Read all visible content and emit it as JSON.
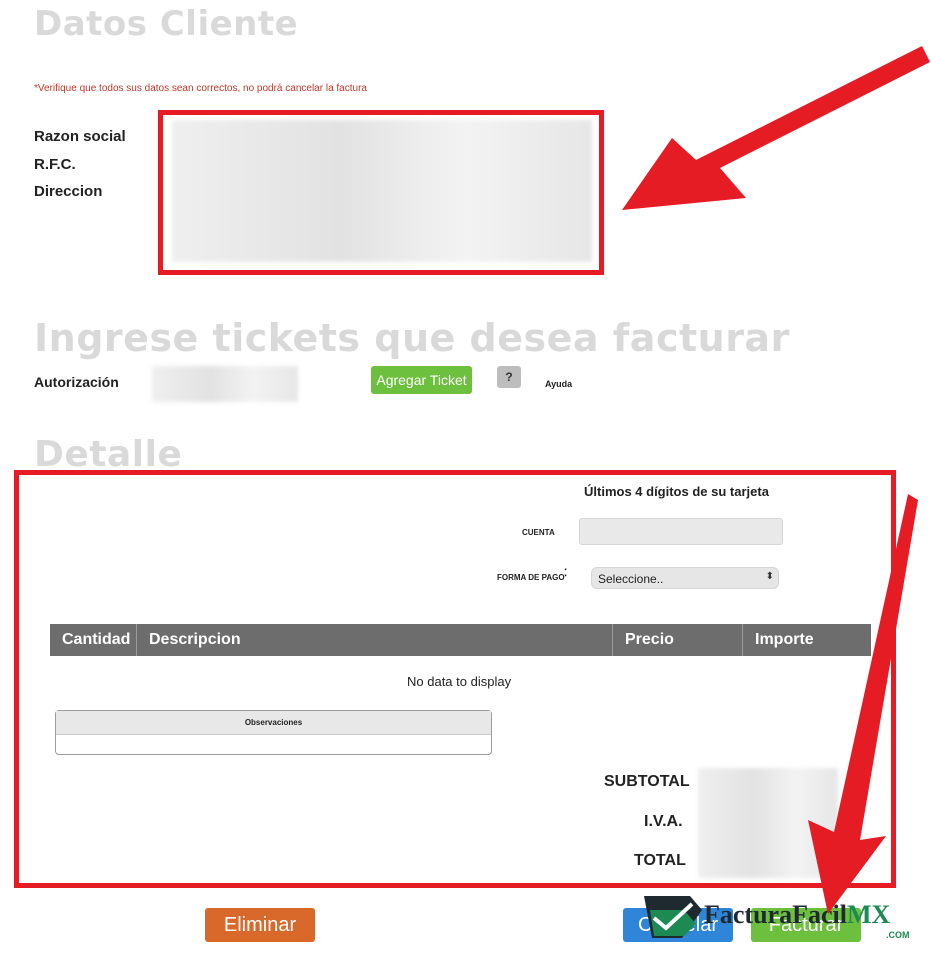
{
  "datos_cliente": {
    "title": "Datos Cliente",
    "warning": "*Verifique que todos sus datos sean correctos, no podrá cancelar la factura",
    "labels": [
      "Razon social",
      "R.F.C.",
      "Direccion"
    ]
  },
  "tickets": {
    "title": "Ingrese tickets que desea facturar",
    "autorizacion_label": "Autorización",
    "agregar_button": "Agregar Ticket",
    "help_button": "?",
    "ayuda_label": "Ayuda"
  },
  "detalle": {
    "title": "Detalle",
    "tarjeta_label": "Últimos 4 dígitos de su tarjeta",
    "cuenta_label": "CUENTA",
    "forma_pago_label": "FORMA DE PAGO",
    "forma_pago_value": "Seleccione..",
    "table_headers": [
      "Cantidad",
      "Descripcion",
      "Precio",
      "Importe"
    ],
    "empty_text": "No data to display",
    "observaciones_label": "Observaciones",
    "subtotal_label": "SUBTOTAL",
    "iva_label": "I.V.A.",
    "total_label": "TOTAL"
  },
  "actions": {
    "eliminar": "Eliminar",
    "cancelar": "Cancelar",
    "facturar": "Facturar"
  },
  "brand": {
    "name": "FacturaFacil",
    "suffix": "MX",
    "domain": ".COM"
  },
  "colors": {
    "highlight_red": "#e51c24",
    "section_title_gray": "#d9d9d9",
    "table_header": "#6d6d6d",
    "green_button": "#6dbf3e",
    "orange_button": "#d9682b",
    "blue_button": "#2f86d8",
    "warning_red": "#c0392b"
  }
}
